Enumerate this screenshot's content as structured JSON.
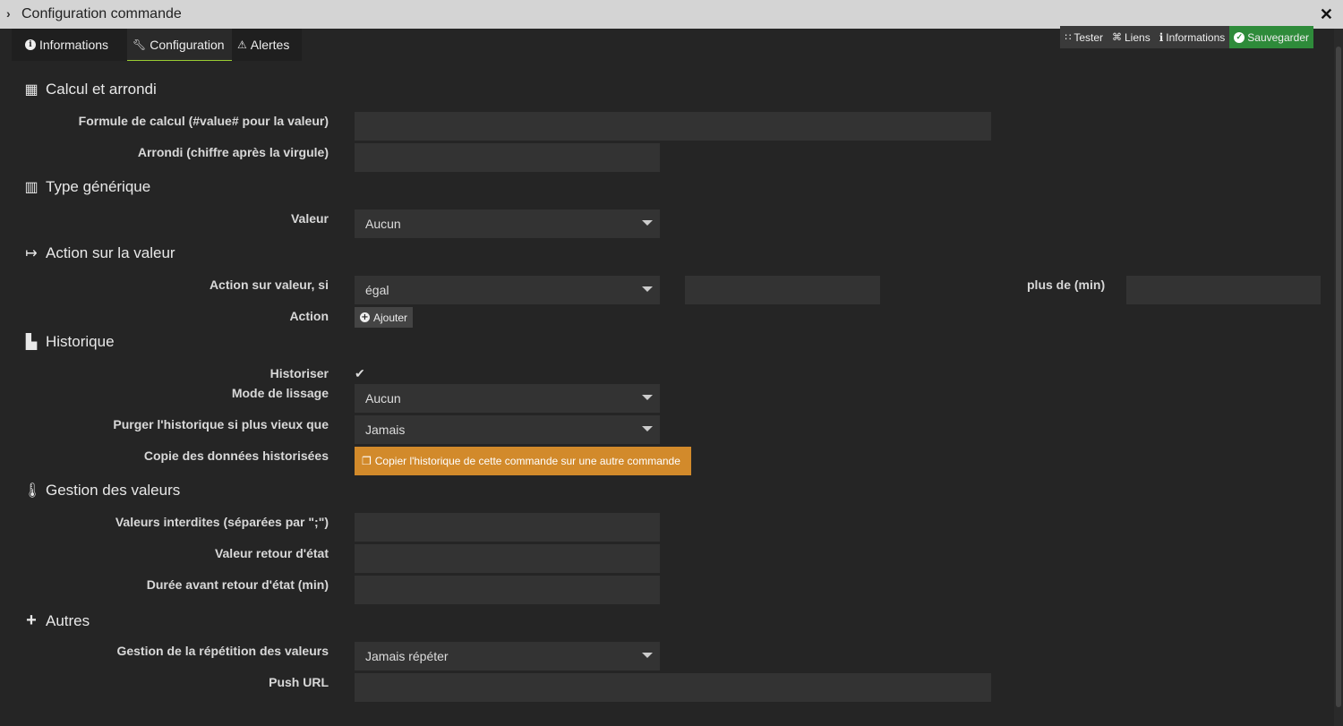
{
  "window": {
    "title": "Configuration commande"
  },
  "tabs": [
    {
      "label": "Informations"
    },
    {
      "label": "Configuration"
    },
    {
      "label": "Alertes"
    }
  ],
  "toolbar": {
    "tester": "Tester",
    "liens": "Liens",
    "informations": "Informations",
    "sauvegarder": "Sauvegarder"
  },
  "sections": {
    "calcul": {
      "title": "Calcul et arrondi",
      "formule_label": "Formule de calcul (#value# pour la valeur)",
      "formule_value": "",
      "arrondi_label": "Arrondi (chiffre après la virgule)",
      "arrondi_value": ""
    },
    "type": {
      "title": "Type générique",
      "valeur_label": "Valeur",
      "valeur_selected": "Aucun"
    },
    "action": {
      "title": "Action sur la valeur",
      "si_label": "Action sur valeur, si",
      "si_selected": "égal",
      "compare_value": "",
      "plus_de_label": "plus de (min)",
      "plus_de_value": "",
      "action_label": "Action",
      "ajouter": "Ajouter"
    },
    "historique": {
      "title": "Historique",
      "historiser_label": "Historiser",
      "historiser_checked": true,
      "lissage_label": "Mode de lissage",
      "lissage_selected": "Aucun",
      "purger_label": "Purger l'historique si plus vieux que",
      "purger_selected": "Jamais",
      "copie_label": "Copie des données historisées",
      "copie_button": "Copier l'historique de cette commande sur une autre commande"
    },
    "gestion": {
      "title": "Gestion des valeurs",
      "interdites_label": "Valeurs interdites (séparées par \";\")",
      "retour_label": "Valeur retour d'état",
      "duree_label": "Durée avant retour d'état (min)"
    },
    "autres": {
      "title": "Autres",
      "repetition_label": "Gestion de la répétition des valeurs",
      "repetition_selected": "Jamais répéter",
      "push_label": "Push URL",
      "push_value": ""
    }
  },
  "colors": {
    "background": "#252525",
    "input": "#333333",
    "save": "#2e8b3a",
    "orange": "#d28a2b",
    "active_tab_underline": "#9acd32"
  }
}
